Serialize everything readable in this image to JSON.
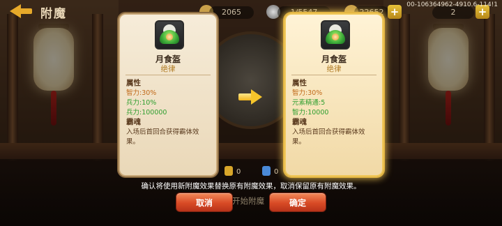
{
  "topbar": {
    "title": "附魔",
    "resources": [
      "2065",
      "1/5547",
      "22652",
      "2"
    ],
    "build_id": "00-106364962-4910.6-114!1"
  },
  "cards": [
    {
      "item_name": "月食盔",
      "quality": "绝律",
      "attributes_label": "属性",
      "attributes": [
        "智力:30%",
        "兵力:10%",
        "兵力:100000"
      ],
      "soul_label": "霸魂",
      "soul_desc": "入场后首回合获得霸体效果。"
    },
    {
      "item_name": "月食盔",
      "quality": "绝律",
      "attributes_label": "属性",
      "attributes": [
        "智力:30%",
        "元素精通:5",
        "智力:10000"
      ],
      "soul_label": "霸魂",
      "soul_desc": "入场后首回合获得霸体效果。"
    }
  ],
  "counters": [
    "0",
    "0"
  ],
  "confirm_message": "确认将使用新附魔效果替换原有附魔效果，取消保留原有附魔效果。",
  "buttons": {
    "cancel": "取消",
    "confirm": "确定",
    "background_action": "开始附魔"
  },
  "colors": {
    "button": "#d84a25",
    "attr_orange": "#c16a1a",
    "attr_green": "#2f9e2f",
    "quality": "#b07a22",
    "glow": "#f0c85a"
  }
}
